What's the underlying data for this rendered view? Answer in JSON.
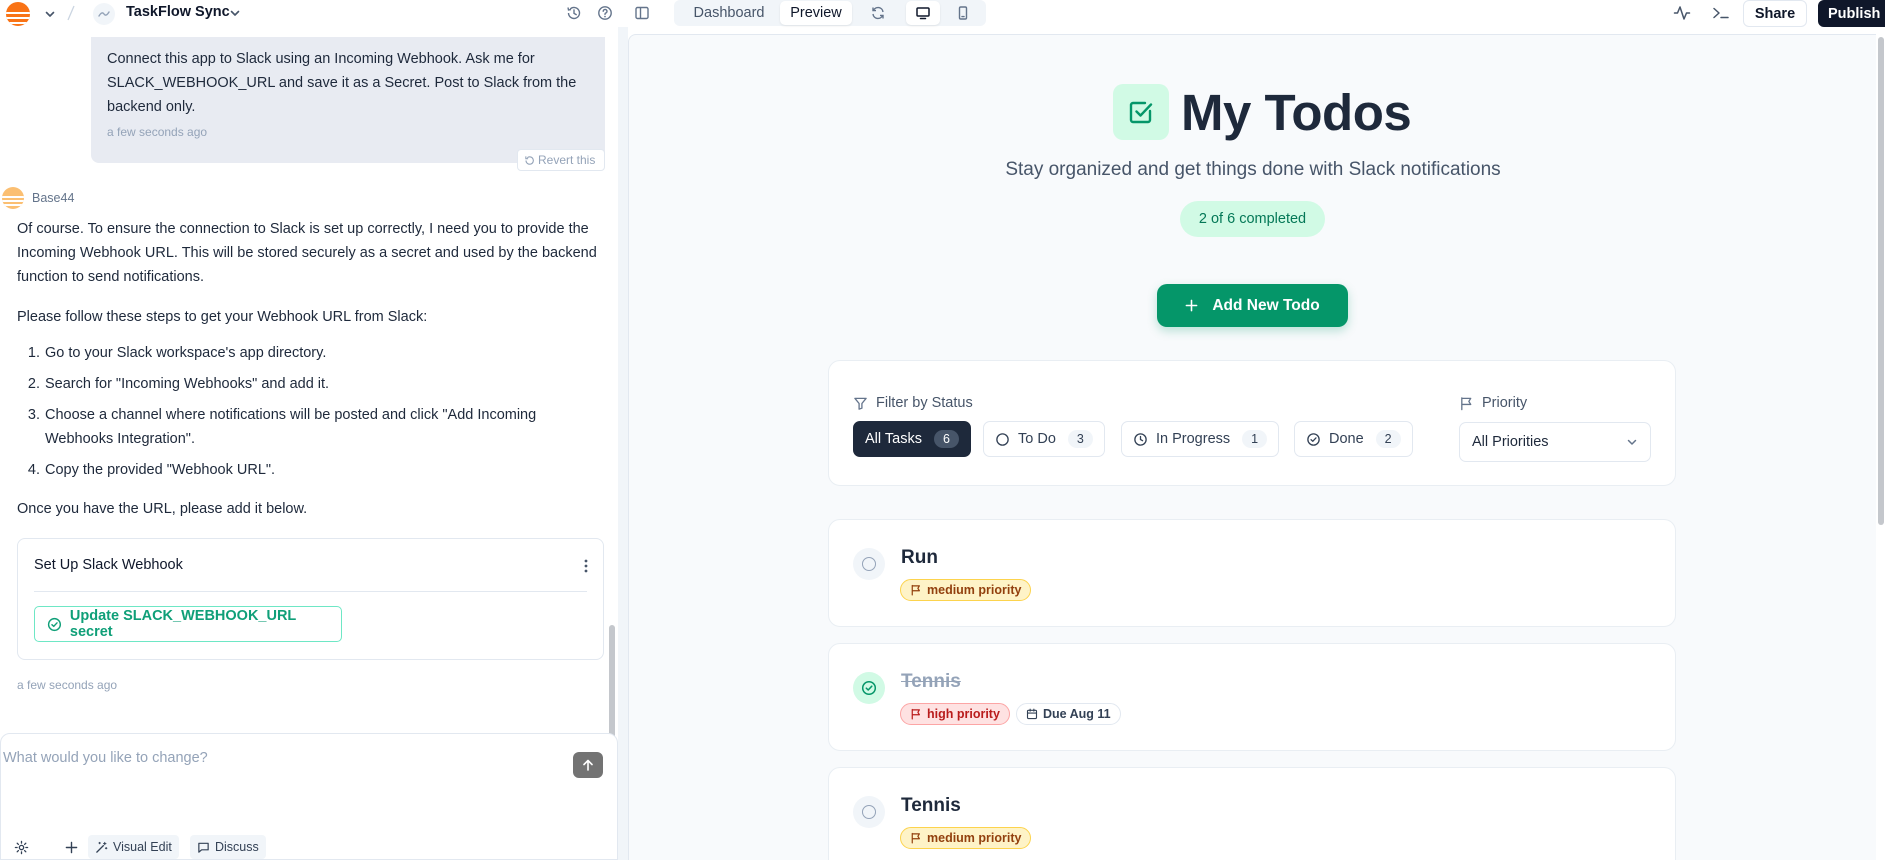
{
  "topbar": {
    "app_name": "TaskFlow Sync",
    "tabs": [
      {
        "label": "Dashboard"
      },
      {
        "label": "Preview"
      }
    ],
    "share_label": "Share",
    "publish_label": "Publish"
  },
  "chat": {
    "user_message": "Connect this app to Slack using an Incoming Webhook. Ask me for SLACK_WEBHOOK_URL and save it as a Secret. Post to Slack from the backend only.",
    "user_time": "a few seconds ago",
    "revert_label": "Revert this",
    "bot_name": "Base44",
    "intro": "Of course. To ensure the connection to Slack is set up correctly, I need you to provide the Incoming Webhook URL. This will be stored securely as a secret and used by the backend function to send notifications.",
    "steps_intro": "Please follow these steps to get your Webhook URL from Slack:",
    "steps": [
      {
        "num": "1.",
        "text": "Go to your Slack workspace's app directory."
      },
      {
        "num": "2.",
        "text": "Search for \"Incoming Webhooks\" and add it."
      },
      {
        "num": "3.",
        "text": "Choose a channel where notifications will be posted and click \"Add Incoming Webhooks Integration\"."
      },
      {
        "num": "4.",
        "text": "Copy the provided \"Webhook URL\"."
      }
    ],
    "outro": "Once you have the URL, please add it below.",
    "card_title": "Set Up Slack Webhook",
    "secret_button": "Update SLACK_WEBHOOK_URL secret",
    "bot_time": "a few seconds ago",
    "input_placeholder": "What would you like to change?",
    "tools": {
      "visual_edit": "Visual Edit",
      "discuss": "Discuss"
    }
  },
  "preview": {
    "title": "My Todos",
    "subtitle": "Stay organized and get things done with Slack notifications",
    "completed_badge": "2 of 6 completed",
    "add_button": "Add New Todo",
    "filter_label": "Filter by Status",
    "priority_label": "Priority",
    "filters": [
      {
        "label": "All Tasks",
        "count": "6"
      },
      {
        "label": "To Do",
        "count": "3"
      },
      {
        "label": "In Progress",
        "count": "1"
      },
      {
        "label": "Done",
        "count": "2"
      }
    ],
    "priority_select": "All Priorities",
    "todos": [
      {
        "title": "Run",
        "priority": "medium priority",
        "done": false
      },
      {
        "title": "Tennis",
        "priority": "high priority",
        "due": "Due Aug 11",
        "done": true
      },
      {
        "title": "Tennis",
        "priority": "medium priority",
        "done": false
      }
    ]
  },
  "colors": {
    "accent": "#059669",
    "accent_light": "#d1fae5",
    "dark": "#0f172a",
    "medium_priority_bg": "#fef3c7",
    "high_priority_bg": "#fee2e2"
  }
}
